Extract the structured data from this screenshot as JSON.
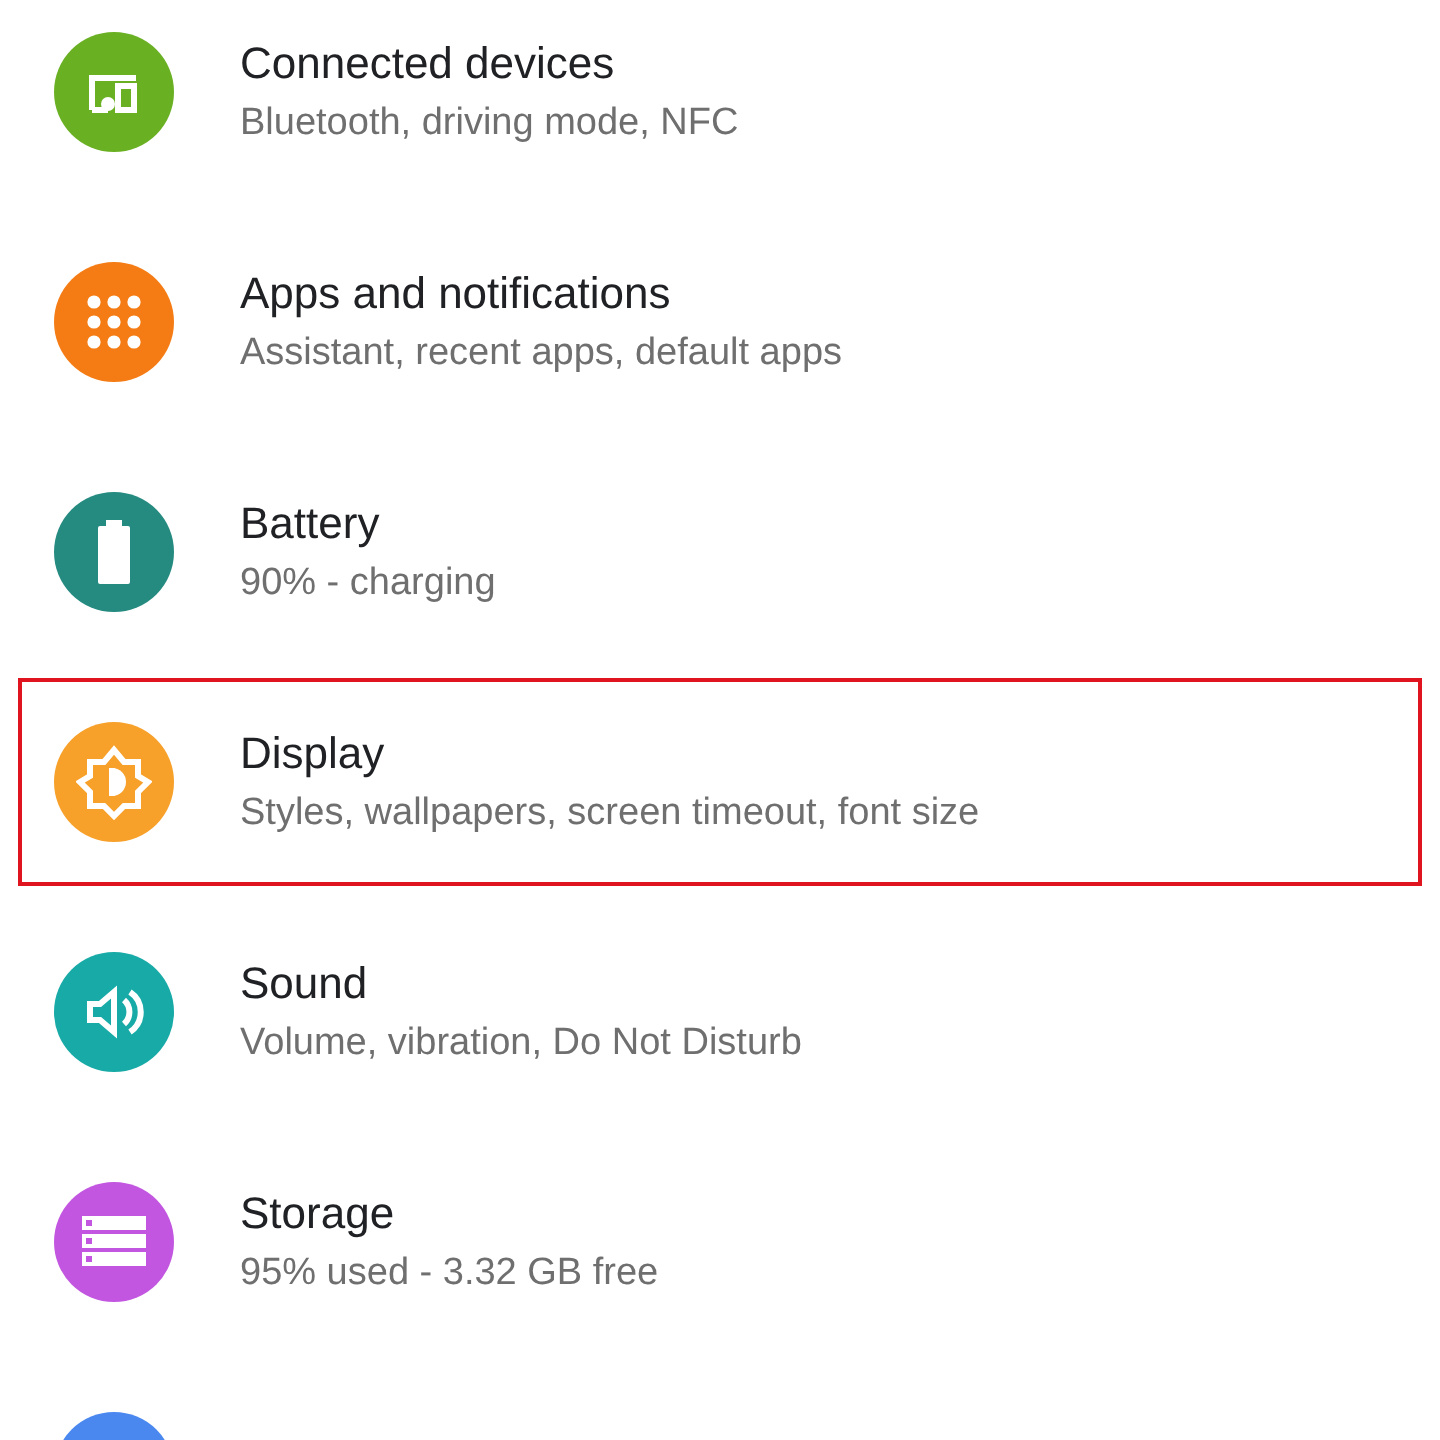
{
  "items": [
    {
      "kind": "devices",
      "color": "#6ab023",
      "title": "Connected devices",
      "subtitle": "Bluetooth, driving mode, NFC",
      "highlighted": false
    },
    {
      "kind": "apps",
      "color": "#f57c14",
      "title": "Apps and notifications",
      "subtitle": "Assistant, recent apps, default apps",
      "highlighted": false
    },
    {
      "kind": "battery",
      "color": "#258a80",
      "title": "Battery",
      "subtitle": "90% - charging",
      "highlighted": false
    },
    {
      "kind": "display",
      "color": "#f7a02a",
      "title": "Display",
      "subtitle": "Styles, wallpapers, screen timeout, font size",
      "highlighted": true
    },
    {
      "kind": "sound",
      "color": "#17aaa6",
      "title": "Sound",
      "subtitle": "Volume, vibration, Do Not Disturb",
      "highlighted": false
    },
    {
      "kind": "storage",
      "color": "#c256e0",
      "title": "Storage",
      "subtitle": "95% used - 3.32 GB free",
      "highlighted": false
    },
    {
      "kind": "cutoff",
      "color": "#4a88f0"
    }
  ]
}
